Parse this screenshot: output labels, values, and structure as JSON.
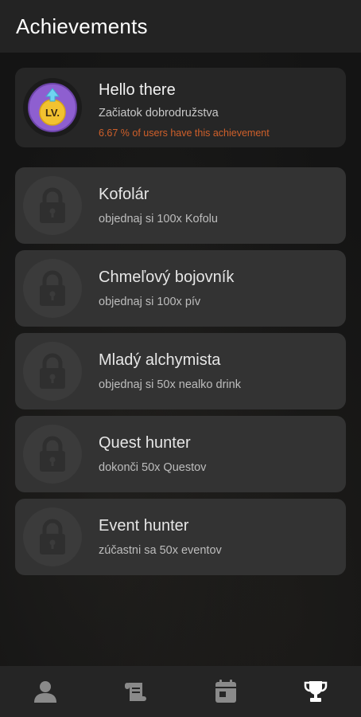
{
  "header": {
    "title": "Achievements"
  },
  "achievements": [
    {
      "title": "Hello there",
      "subtitle": "Začiatok dobrodružstva",
      "stat": "6.67 % of users have this achievement",
      "unlocked": true,
      "badge_text": "LV."
    },
    {
      "title": "Kofolár",
      "subtitle": "objednaj si 100x Kofolu",
      "unlocked": false
    },
    {
      "title": "Chmeľový bojovník",
      "subtitle": "objednaj si 100x pív",
      "unlocked": false
    },
    {
      "title": "Mladý alchymista",
      "subtitle": "objednaj si 50x nealko drink",
      "unlocked": false
    },
    {
      "title": "Quest hunter",
      "subtitle": "dokonči 50x Questov",
      "unlocked": false
    },
    {
      "title": "Event hunter",
      "subtitle": "zúčastni sa 50x eventov",
      "unlocked": false
    }
  ],
  "bottom_nav": [
    {
      "icon": "person-icon",
      "active": false
    },
    {
      "icon": "scroll-icon",
      "active": false
    },
    {
      "icon": "calendar-icon",
      "active": false
    },
    {
      "icon": "trophy-icon",
      "active": true
    }
  ],
  "colors": {
    "background": "#141414",
    "header": "#232323",
    "card_locked": "#333333",
    "card_unlocked": "#262626",
    "stat_accent": "#d0602a",
    "nav_icon": "#8a8a8a",
    "nav_icon_active": "#ffffff",
    "badge_purple": "#8e5fd0",
    "badge_gold": "#f2c230",
    "badge_arrow": "#6fd3f0"
  }
}
